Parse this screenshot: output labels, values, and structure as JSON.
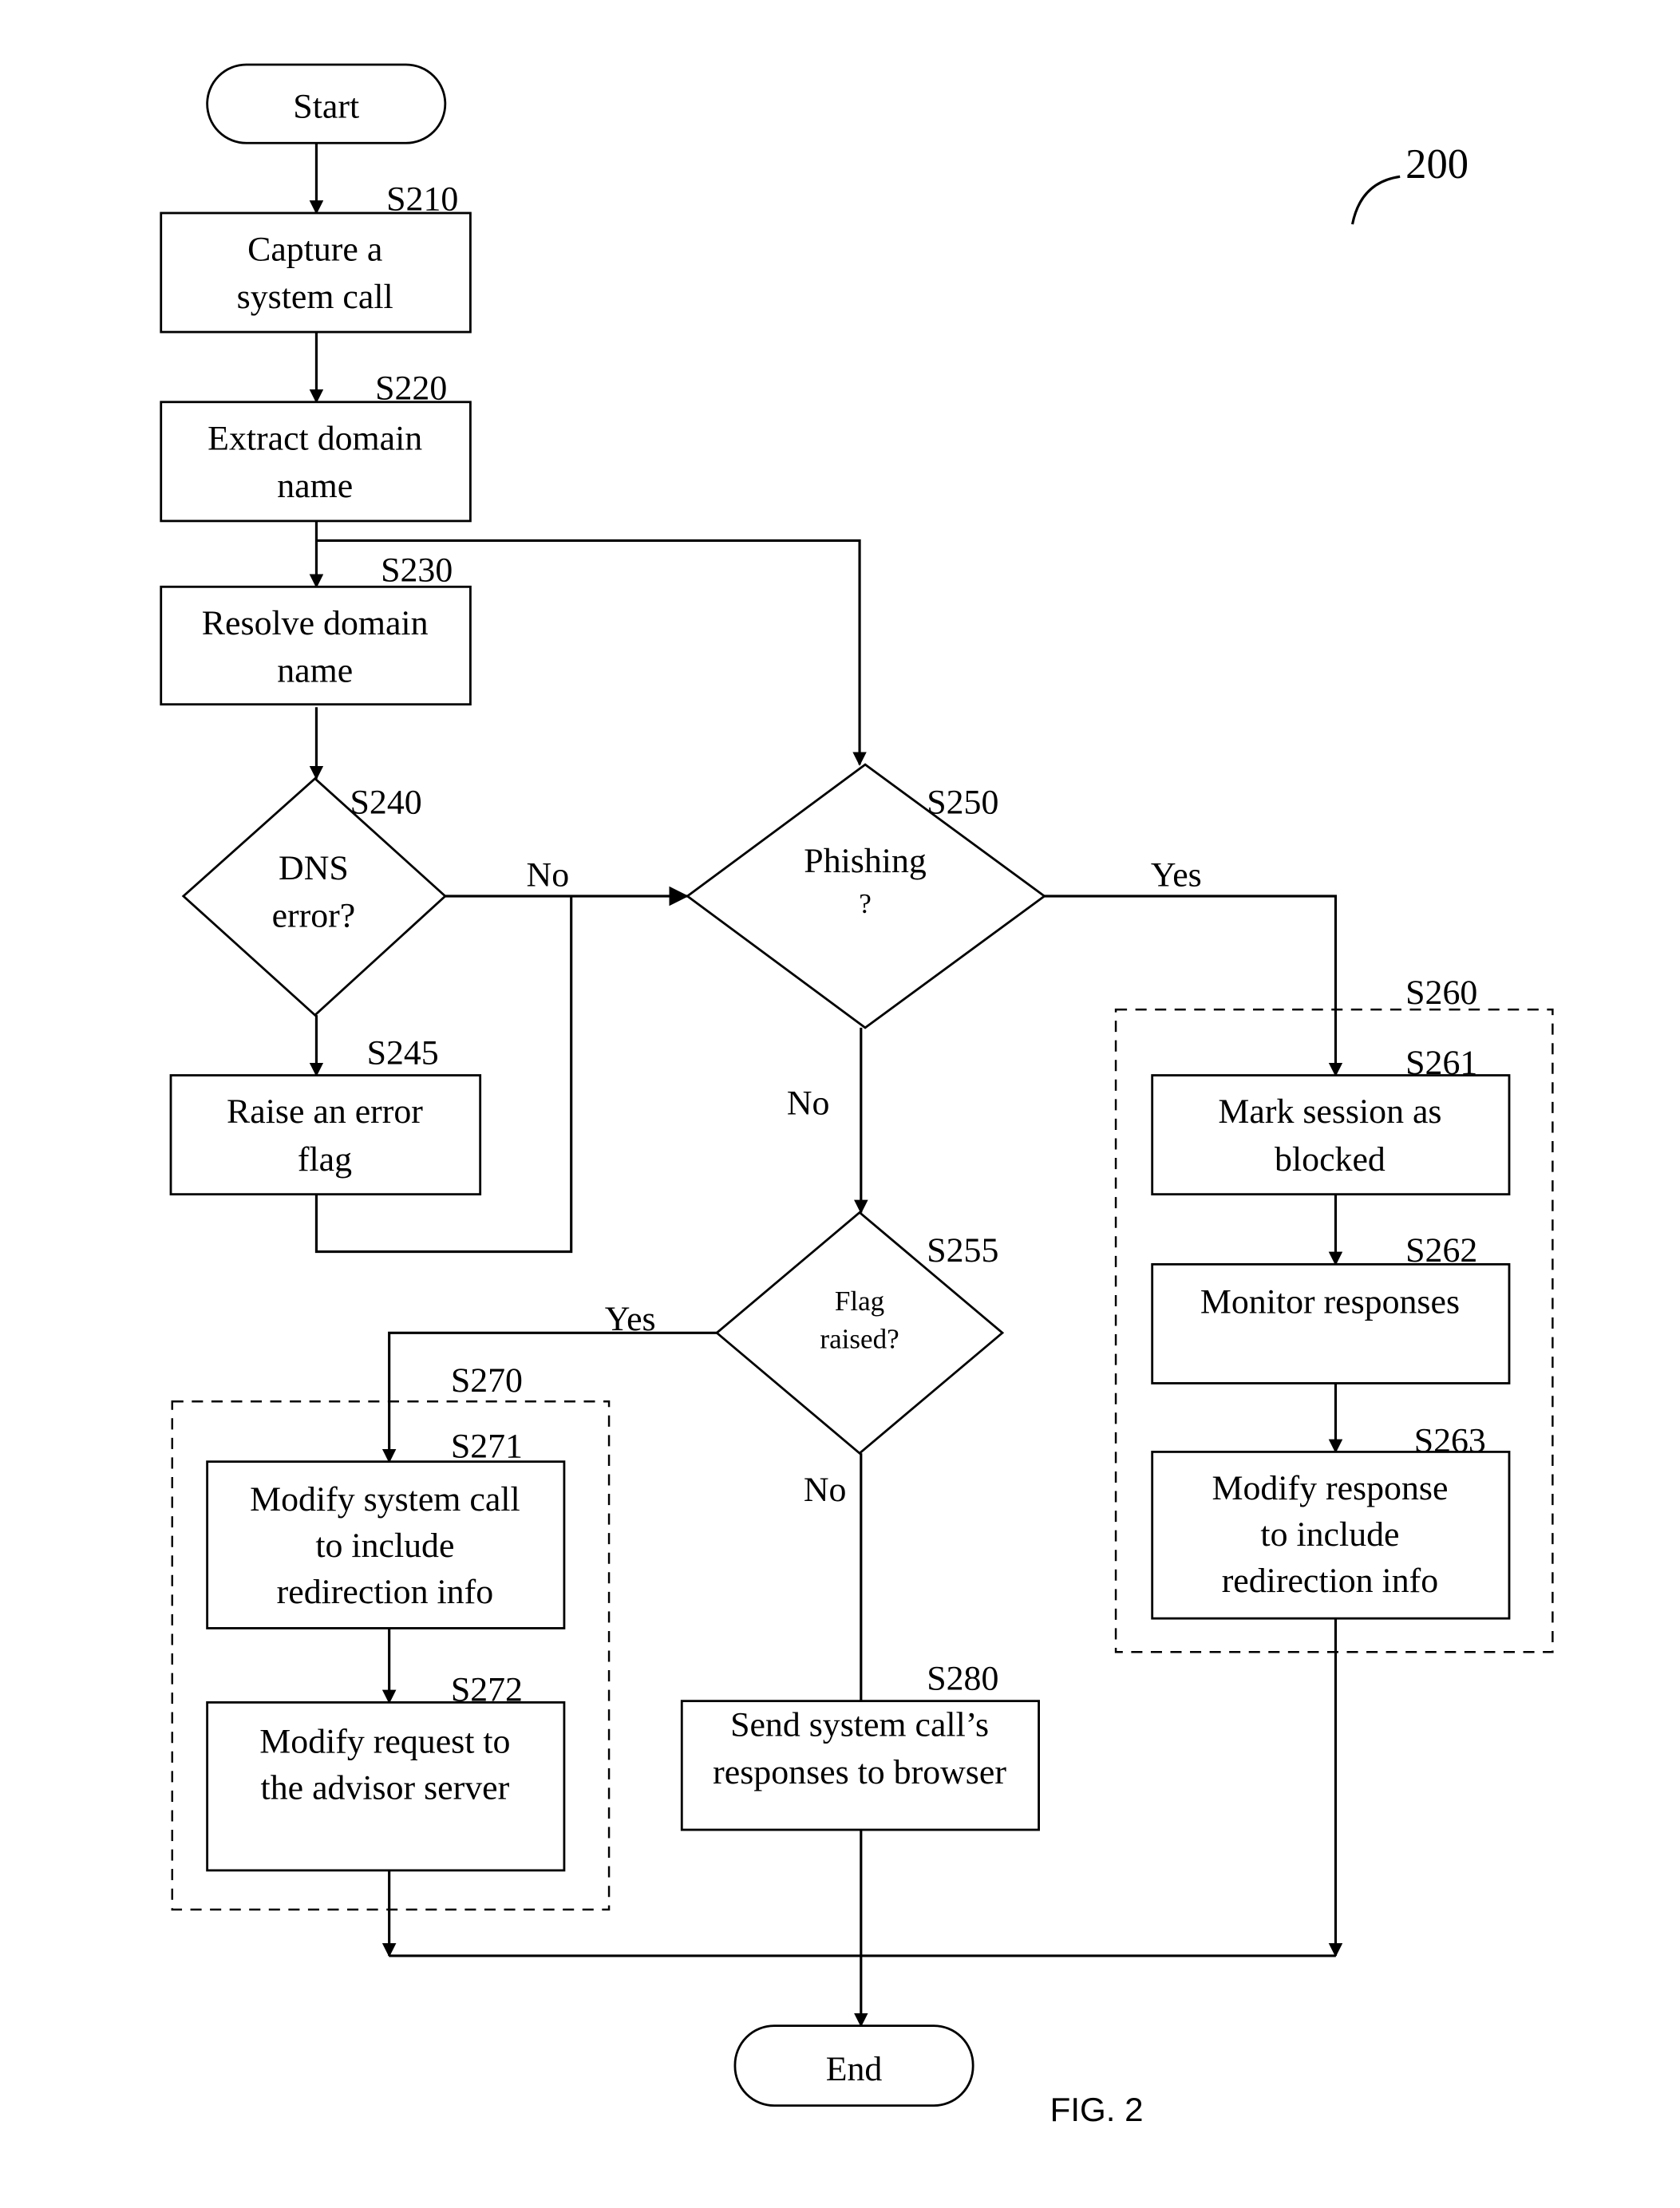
{
  "figure": {
    "number": "FIG. 2",
    "reference": "200"
  },
  "terminals": {
    "start": "Start",
    "end": "End"
  },
  "steps": {
    "s210": {
      "id": "S210",
      "lines": [
        "Capture a",
        "system call"
      ]
    },
    "s220": {
      "id": "S220",
      "lines": [
        "Extract domain",
        "name"
      ]
    },
    "s230": {
      "id": "S230",
      "lines": [
        "Resolve domain",
        "name"
      ]
    },
    "s240": {
      "id": "S240",
      "lines": [
        "DNS",
        "error?"
      ]
    },
    "s245": {
      "id": "S245",
      "lines": [
        "Raise an error",
        "flag"
      ]
    },
    "s250": {
      "id": "S250",
      "lines": [
        "Phishing",
        "?"
      ]
    },
    "s255": {
      "id": "S255",
      "lines": [
        "Flag",
        "raised?"
      ]
    },
    "s260": {
      "id": "S260"
    },
    "s261": {
      "id": "S261",
      "lines": [
        "Mark session as",
        "blocked"
      ]
    },
    "s262": {
      "id": "S262",
      "lines": [
        "Monitor responses"
      ]
    },
    "s263": {
      "id": "S263",
      "lines": [
        "Modify response",
        "to include",
        "redirection info"
      ]
    },
    "s270": {
      "id": "S270"
    },
    "s271": {
      "id": "S271",
      "lines": [
        "Modify system call",
        "to include",
        "redirection info"
      ]
    },
    "s272": {
      "id": "S272",
      "lines": [
        "Modify request to",
        "the advisor server"
      ]
    },
    "s280": {
      "id": "S280",
      "lines": [
        "Send system call’s",
        "responses to browser"
      ]
    }
  },
  "edge_labels": {
    "s240_no": "No",
    "s250_yes": "Yes",
    "s250_no": "No",
    "s255_yes": "Yes",
    "s255_no": "No"
  }
}
